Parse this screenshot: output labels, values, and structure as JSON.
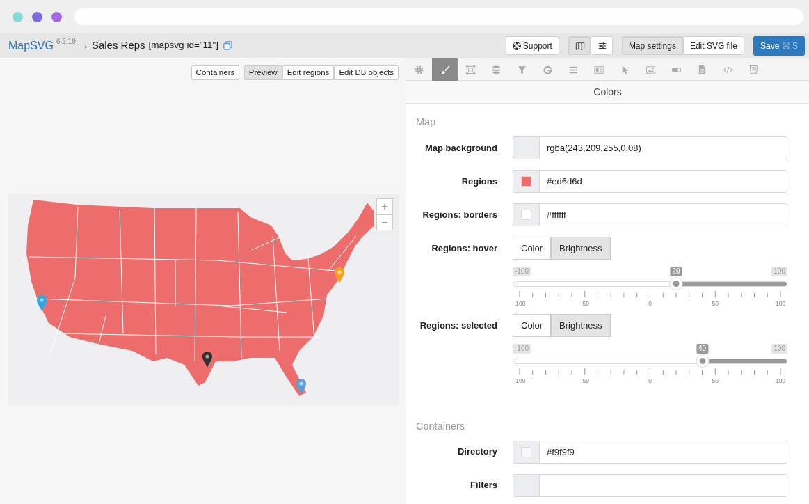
{
  "window": {
    "dots": [
      {
        "color": "#84dcd6"
      },
      {
        "color": "#7a6cdc"
      },
      {
        "color": "#a46ae2"
      }
    ]
  },
  "header": {
    "title": "MapSVG",
    "version": "6.2.19",
    "breadcrumb": "→ Sales Reps",
    "shortcode": "[mapsvg id=\"11\"]",
    "support": "Support",
    "view_buttons": [
      {
        "kind": "map",
        "selected": true
      },
      {
        "kind": "sliders",
        "selected": false
      }
    ],
    "mode_tabs": [
      {
        "label": "Map settings",
        "selected": true
      },
      {
        "label": "Edit SVG file",
        "selected": false
      }
    ],
    "save": {
      "label": "Save",
      "shortcut": "⌘ S"
    }
  },
  "preview": {
    "containers_button": "Containers",
    "view_tabs": [
      {
        "label": "Preview",
        "selected": true
      },
      {
        "label": "Edit regions",
        "selected": false
      },
      {
        "label": "Edit DB objects",
        "selected": false
      }
    ],
    "map": {
      "zoom_in": "+",
      "zoom_out": "−",
      "markers": [
        {
          "color": "#2aa9e4"
        },
        {
          "color": "#f2a31f"
        },
        {
          "color": "#2f2f2f"
        },
        {
          "color": "#5d9dd3"
        }
      ]
    }
  },
  "settings": {
    "tool_tabs": [
      {
        "kind": "gear",
        "selected": false
      },
      {
        "kind": "brush",
        "selected": true
      },
      {
        "kind": "frame",
        "selected": false
      },
      {
        "kind": "database",
        "selected": false
      },
      {
        "kind": "filter",
        "selected": false
      },
      {
        "kind": "g",
        "selected": false
      },
      {
        "kind": "list",
        "selected": false
      },
      {
        "kind": "card",
        "selected": false
      },
      {
        "kind": "pointer",
        "selected": false
      },
      {
        "kind": "image",
        "selected": false
      },
      {
        "kind": "toggle",
        "selected": false
      },
      {
        "kind": "file",
        "selected": false
      },
      {
        "kind": "code",
        "selected": false
      },
      {
        "kind": "shield",
        "selected": false
      }
    ],
    "panel_title": "Colors",
    "sections": [
      {
        "title": "Map",
        "rows": [
          {
            "kind": "color",
            "label": "Map background",
            "value": "rgba(243,209,255,0.08)"
          },
          {
            "kind": "color",
            "label": "Regions",
            "value": "#ed6d6d",
            "color": "#ed6d6d"
          },
          {
            "kind": "color",
            "label": "Regions: borders",
            "value": "#ffffff",
            "color": "#ffffff"
          },
          {
            "kind": "mode",
            "label": "Regions: hover",
            "options": [
              {
                "label": "Color",
                "selected": false
              },
              {
                "label": "Brightness",
                "selected": true
              }
            ],
            "slider": {
              "min_label": "-100",
              "max_label": "100",
              "value_label": "20",
              "level": 0.6,
              "ticks": [
                "-100",
                "-50",
                "0",
                "50",
                "100"
              ]
            }
          },
          {
            "kind": "mode",
            "label": "Regions: selected",
            "options": [
              {
                "label": "Color",
                "selected": false
              },
              {
                "label": "Brightness",
                "selected": true
              }
            ],
            "slider": {
              "min_label": "-100",
              "max_label": "100",
              "value_label": "40",
              "level": 0.7,
              "ticks": [
                "-100",
                "-50",
                "0",
                "50",
                "100"
              ]
            }
          }
        ]
      },
      {
        "title": "Containers",
        "rows": [
          {
            "kind": "color",
            "label": "Directory",
            "value": "#f9f9f9",
            "color": "#f9f9f9"
          },
          {
            "kind": "color",
            "label": "Filters"
          }
        ]
      }
    ]
  }
}
